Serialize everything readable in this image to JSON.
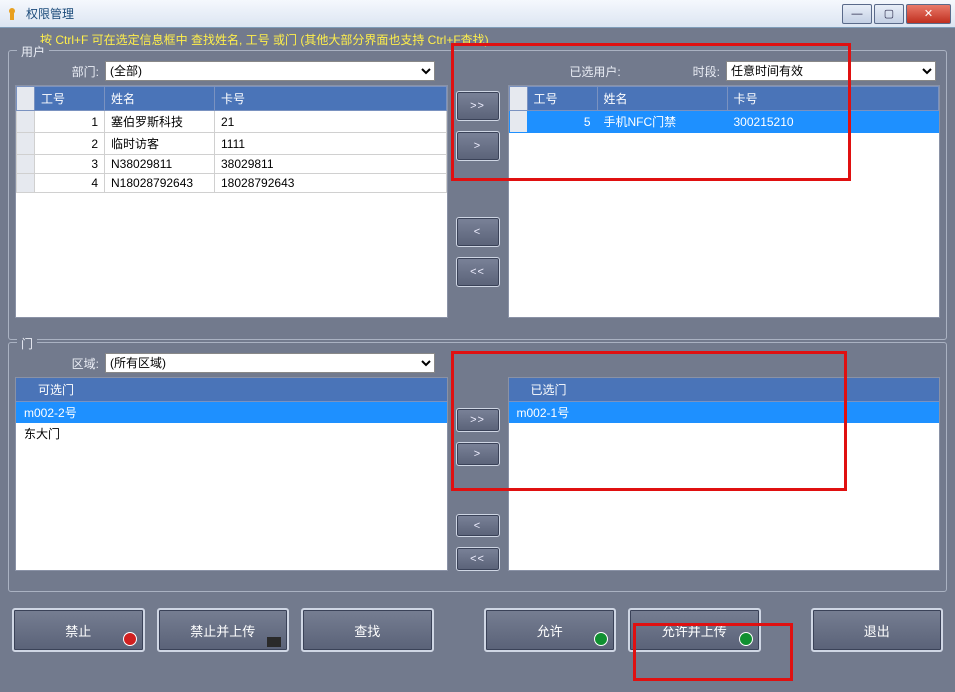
{
  "window": {
    "title": "权限管理"
  },
  "hint": "按 Ctrl+F 可在选定信息框中 查找姓名, 工号 或门 (其他大部分界面也支持 Ctrl+F查找)",
  "userFrame": {
    "label": "用户",
    "deptLabel": "部门:",
    "deptValue": "(全部)",
    "selectedLabel": "已选用户:",
    "periodLabel": "时段:",
    "periodValue": "任意时间有效",
    "leftHeaders": {
      "empNo": "工号",
      "name": "姓名",
      "card": "卡号"
    },
    "leftRows": [
      {
        "n": "1",
        "empNo": "",
        "name": "塞伯罗斯科技",
        "card": "21"
      },
      {
        "n": "2",
        "empNo": "",
        "name": "临时访客",
        "card": "1111"
      },
      {
        "n": "3",
        "empNo": "N38029811",
        "name": "",
        "card": "38029811"
      },
      {
        "n": "4",
        "empNo": "N18028792643",
        "name": "",
        "card": "18028792643"
      }
    ],
    "rightHeaders": {
      "empNo": "工号",
      "name": "姓名",
      "card": "卡号"
    },
    "rightRows": [
      {
        "n": "5",
        "empNo": "",
        "name": "手机NFC门禁",
        "card": "300215210"
      }
    ]
  },
  "doorFrame": {
    "label": "门",
    "areaLabel": "区域:",
    "areaValue": "(所有区域)",
    "availHeader": "可选门",
    "availItems": [
      "m002-2号",
      "东大门"
    ],
    "selHeader": "已选门",
    "selItems": [
      "m002-1号"
    ]
  },
  "buttons": {
    "addAll": ">>",
    "addOne": ">",
    "removeOne": "<",
    "removeAll": "<<",
    "deny": "禁止",
    "denyUpload": "禁止并上传",
    "find": "查找",
    "allow": "允许",
    "allowUpload": "允许并上传",
    "exit": "退出"
  }
}
